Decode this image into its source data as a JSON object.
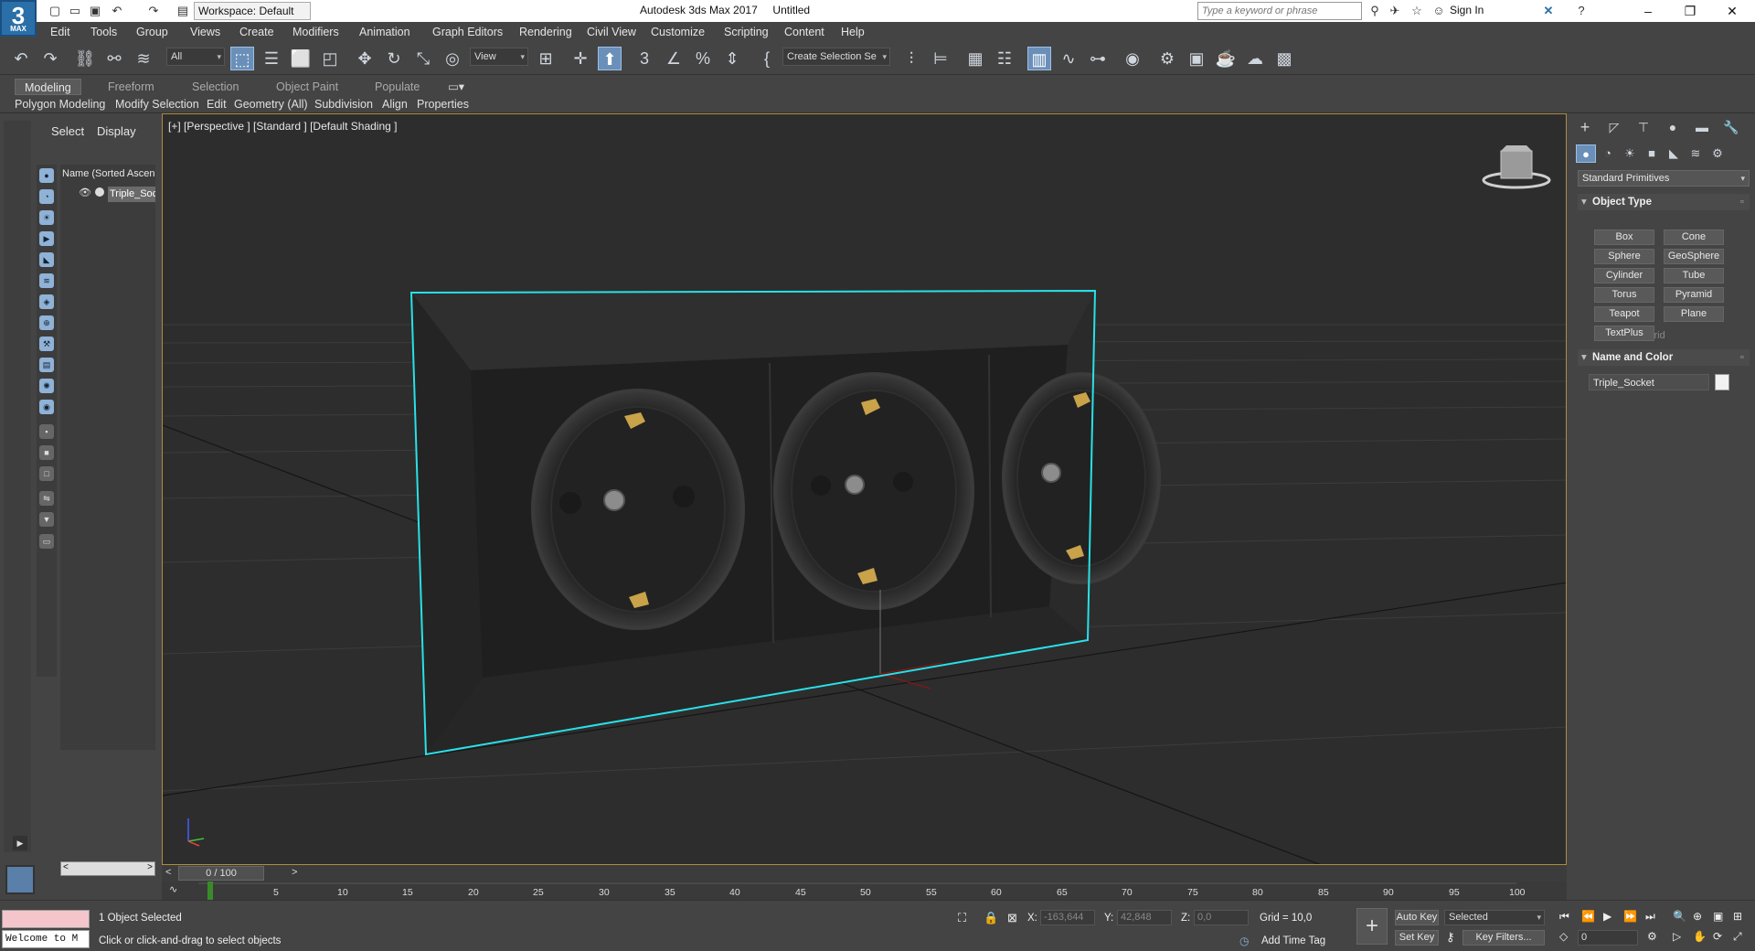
{
  "title_bar": {
    "logo_text": "3",
    "logo_sub": "MAX",
    "workspace": "Workspace: Default",
    "app_title": "Autodesk 3ds Max 2017",
    "document": "Untitled",
    "search_placeholder": "Type a keyword or phrase",
    "sign_in": "Sign In"
  },
  "menu": [
    "Edit",
    "Tools",
    "Group",
    "Views",
    "Create",
    "Modifiers",
    "Animation",
    "Graph Editors",
    "Rendering",
    "Civil View",
    "Customize",
    "Scripting",
    "Content",
    "Help"
  ],
  "toolbar": {
    "filter": "All",
    "ref_coord": "View",
    "selection_set": "Create Selection Se"
  },
  "ribbon": {
    "tabs": [
      "Modeling",
      "Freeform",
      "Selection",
      "Object Paint",
      "Populate"
    ],
    "subtabs": [
      "Polygon Modeling",
      "Modify Selection",
      "Edit",
      "Geometry (All)",
      "Subdivision",
      "Align",
      "Properties"
    ]
  },
  "explorer": {
    "tabs": [
      "Select",
      "Display"
    ],
    "header": "Name (Sorted Ascending)",
    "item": "Triple_Socket"
  },
  "viewport": {
    "label": "[+] [Perspective ] [Standard ] [Default Shading ]"
  },
  "command_panel": {
    "category": "Standard Primitives",
    "object_type_title": "Object Type",
    "autogrid": "AutoGrid",
    "buttons": [
      "Box",
      "Cone",
      "Sphere",
      "GeoSphere",
      "Cylinder",
      "Tube",
      "Torus",
      "Pyramid",
      "Teapot",
      "Plane",
      "TextPlus"
    ],
    "name_color_title": "Name and Color",
    "object_name": "Triple_Socket"
  },
  "time": {
    "slider": "0 / 100",
    "ticks": [
      "5",
      "10",
      "15",
      "20",
      "25",
      "30",
      "35",
      "40",
      "45",
      "50",
      "55",
      "60",
      "65",
      "70",
      "75",
      "80",
      "85",
      "90",
      "95",
      "100"
    ]
  },
  "status": {
    "maxscript_output": "Welcome to M",
    "selected": "1 Object Selected",
    "prompt": "Click or click-and-drag to select objects",
    "x_label": "X:",
    "x_value": "-163,644",
    "y_label": "Y:",
    "y_value": "42,848",
    "z_label": "Z:",
    "z_value": "0,0",
    "grid": "Grid = 10,0",
    "add_time_tag": "Add Time Tag",
    "auto_key": "Auto Key",
    "set_key": "Set Key",
    "key_mode": "Selected",
    "key_filters": "Key Filters...",
    "frame": "0"
  },
  "colors": {
    "selection_outline": "#29e0e8",
    "viewport_border": "#b08c3e",
    "active_button": "#6a8fb8",
    "brass": "#c9a24a"
  }
}
